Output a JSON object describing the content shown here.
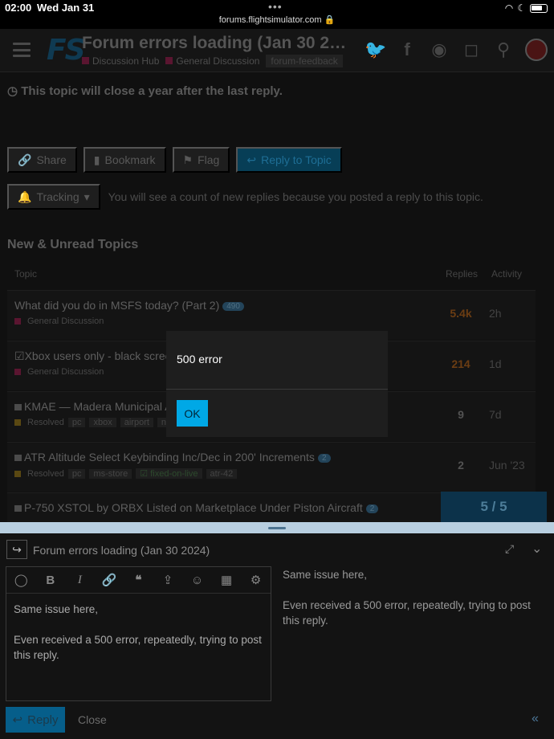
{
  "status_bar": {
    "time": "02:00",
    "date": "Wed Jan 31",
    "url": "forums.flightsimulator.com 🔒"
  },
  "header": {
    "logo": "FS",
    "title": "Forum errors loading (Jan 30 2…",
    "categories": [
      "Discussion Hub",
      "General Discussion"
    ],
    "tag": "forum-feedback"
  },
  "topic_notice": "This topic will close a year after the last reply.",
  "actions": {
    "share": "Share",
    "bookmark": "Bookmark",
    "flag": "Flag",
    "reply": "Reply to Topic"
  },
  "tracking": {
    "label": "Tracking",
    "note": "You will see a count of new replies because you posted a reply to this topic."
  },
  "section_title": "New & Unread Topics",
  "table_headers": {
    "topic": "Topic",
    "replies": "Replies",
    "activity": "Activity"
  },
  "topics": [
    {
      "title": "What did you do in MSFS today? (Part 2)",
      "badge": "490",
      "category": "General Discussion",
      "tags": [],
      "replies": "5.4k",
      "activity": "2h"
    },
    {
      "title": "Xbox users only - black scree",
      "category": "General Discussion",
      "tags": [],
      "replies": "214",
      "activity": "1d"
    },
    {
      "title": "KMAE — Madera Municipal A",
      "category": "Resolved",
      "tags": [
        "pc",
        "xbox",
        "airport",
        "no"
      ],
      "replies": "9",
      "activity": "7d"
    },
    {
      "title": "ATR Altitude Select Keybinding Inc/Dec in 200' Increments",
      "badge": "2",
      "category": "Resolved",
      "tags": [
        "pc",
        "ms-store",
        "fixed-on-live",
        "atr-42"
      ],
      "replies": "2",
      "activity": "Jun '23"
    },
    {
      "title": "P-750 XSTOL by ORBX Listed on Marketplace Under Piston Aircraft",
      "badge": "2"
    }
  ],
  "progress": "5 / 5",
  "modal": {
    "message": "500 error",
    "ok": "OK"
  },
  "composer": {
    "title": "Forum errors loading (Jan 30 2024)",
    "editor_lines": [
      "Same issue here,",
      "Even received a 500 error, repeatedly, trying to post this reply."
    ],
    "preview_lines": [
      "Same issue here,",
      "Even received a 500 error, repeatedly, trying to post this reply."
    ],
    "reply_label": "Reply",
    "close_label": "Close"
  }
}
